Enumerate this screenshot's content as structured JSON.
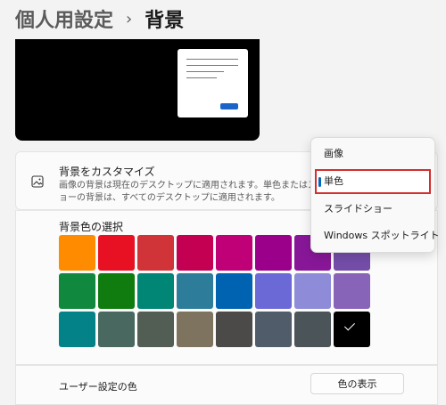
{
  "header": {
    "parent": "個人用設定",
    "separator": "›",
    "title": "背景"
  },
  "background_setting": {
    "icon": "picture-icon",
    "title": "背景をカスタマイズ",
    "description": "画像の背景は現在のデスクトップに適用されます。単色またはスライドショーの背景は、すべてのデスクトップに適用されます。"
  },
  "dropdown": {
    "options": [
      "画像",
      "単色",
      "スライドショー",
      "Windows スポットライト"
    ],
    "selected": "単色"
  },
  "colors_section": {
    "title": "背景色の選択",
    "selected_color": "#000000",
    "colors": [
      [
        "#ff8c00",
        "#e81123",
        "#d13438",
        "#c30052",
        "#bf0077",
        "#9a0089",
        "#881798",
        "#744da9"
      ],
      [
        "#10893e",
        "#107c10",
        "#018574",
        "#2d7d9a",
        "#0063b1",
        "#6b69d6",
        "#8e8cd8",
        "#8764b8"
      ],
      [
        "#038387",
        "#486860",
        "#525e54",
        "#7e735f",
        "#4c4a48",
        "#515c6b",
        "#4a5459",
        "#000000"
      ]
    ]
  },
  "custom_color": {
    "label": "ユーザー設定の色",
    "button_label": "色の表示"
  }
}
